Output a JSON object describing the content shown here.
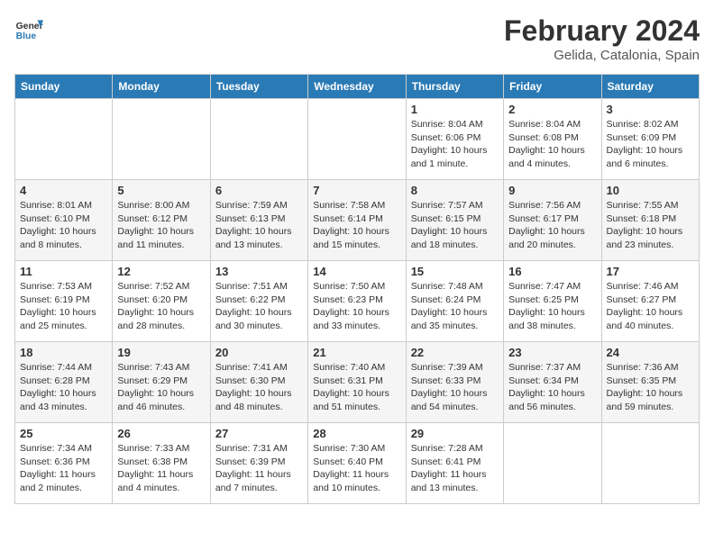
{
  "header": {
    "logo_text_general": "General",
    "logo_text_blue": "Blue",
    "title": "February 2024",
    "subtitle": "Gelida, Catalonia, Spain"
  },
  "weekdays": [
    "Sunday",
    "Monday",
    "Tuesday",
    "Wednesday",
    "Thursday",
    "Friday",
    "Saturday"
  ],
  "weeks": [
    [
      {
        "day": "",
        "info": ""
      },
      {
        "day": "",
        "info": ""
      },
      {
        "day": "",
        "info": ""
      },
      {
        "day": "",
        "info": ""
      },
      {
        "day": "1",
        "info": "Sunrise: 8:04 AM\nSunset: 6:06 PM\nDaylight: 10 hours and 1 minute."
      },
      {
        "day": "2",
        "info": "Sunrise: 8:04 AM\nSunset: 6:08 PM\nDaylight: 10 hours and 4 minutes."
      },
      {
        "day": "3",
        "info": "Sunrise: 8:02 AM\nSunset: 6:09 PM\nDaylight: 10 hours and 6 minutes."
      }
    ],
    [
      {
        "day": "4",
        "info": "Sunrise: 8:01 AM\nSunset: 6:10 PM\nDaylight: 10 hours and 8 minutes."
      },
      {
        "day": "5",
        "info": "Sunrise: 8:00 AM\nSunset: 6:12 PM\nDaylight: 10 hours and 11 minutes."
      },
      {
        "day": "6",
        "info": "Sunrise: 7:59 AM\nSunset: 6:13 PM\nDaylight: 10 hours and 13 minutes."
      },
      {
        "day": "7",
        "info": "Sunrise: 7:58 AM\nSunset: 6:14 PM\nDaylight: 10 hours and 15 minutes."
      },
      {
        "day": "8",
        "info": "Sunrise: 7:57 AM\nSunset: 6:15 PM\nDaylight: 10 hours and 18 minutes."
      },
      {
        "day": "9",
        "info": "Sunrise: 7:56 AM\nSunset: 6:17 PM\nDaylight: 10 hours and 20 minutes."
      },
      {
        "day": "10",
        "info": "Sunrise: 7:55 AM\nSunset: 6:18 PM\nDaylight: 10 hours and 23 minutes."
      }
    ],
    [
      {
        "day": "11",
        "info": "Sunrise: 7:53 AM\nSunset: 6:19 PM\nDaylight: 10 hours and 25 minutes."
      },
      {
        "day": "12",
        "info": "Sunrise: 7:52 AM\nSunset: 6:20 PM\nDaylight: 10 hours and 28 minutes."
      },
      {
        "day": "13",
        "info": "Sunrise: 7:51 AM\nSunset: 6:22 PM\nDaylight: 10 hours and 30 minutes."
      },
      {
        "day": "14",
        "info": "Sunrise: 7:50 AM\nSunset: 6:23 PM\nDaylight: 10 hours and 33 minutes."
      },
      {
        "day": "15",
        "info": "Sunrise: 7:48 AM\nSunset: 6:24 PM\nDaylight: 10 hours and 35 minutes."
      },
      {
        "day": "16",
        "info": "Sunrise: 7:47 AM\nSunset: 6:25 PM\nDaylight: 10 hours and 38 minutes."
      },
      {
        "day": "17",
        "info": "Sunrise: 7:46 AM\nSunset: 6:27 PM\nDaylight: 10 hours and 40 minutes."
      }
    ],
    [
      {
        "day": "18",
        "info": "Sunrise: 7:44 AM\nSunset: 6:28 PM\nDaylight: 10 hours and 43 minutes."
      },
      {
        "day": "19",
        "info": "Sunrise: 7:43 AM\nSunset: 6:29 PM\nDaylight: 10 hours and 46 minutes."
      },
      {
        "day": "20",
        "info": "Sunrise: 7:41 AM\nSunset: 6:30 PM\nDaylight: 10 hours and 48 minutes."
      },
      {
        "day": "21",
        "info": "Sunrise: 7:40 AM\nSunset: 6:31 PM\nDaylight: 10 hours and 51 minutes."
      },
      {
        "day": "22",
        "info": "Sunrise: 7:39 AM\nSunset: 6:33 PM\nDaylight: 10 hours and 54 minutes."
      },
      {
        "day": "23",
        "info": "Sunrise: 7:37 AM\nSunset: 6:34 PM\nDaylight: 10 hours and 56 minutes."
      },
      {
        "day": "24",
        "info": "Sunrise: 7:36 AM\nSunset: 6:35 PM\nDaylight: 10 hours and 59 minutes."
      }
    ],
    [
      {
        "day": "25",
        "info": "Sunrise: 7:34 AM\nSunset: 6:36 PM\nDaylight: 11 hours and 2 minutes."
      },
      {
        "day": "26",
        "info": "Sunrise: 7:33 AM\nSunset: 6:38 PM\nDaylight: 11 hours and 4 minutes."
      },
      {
        "day": "27",
        "info": "Sunrise: 7:31 AM\nSunset: 6:39 PM\nDaylight: 11 hours and 7 minutes."
      },
      {
        "day": "28",
        "info": "Sunrise: 7:30 AM\nSunset: 6:40 PM\nDaylight: 11 hours and 10 minutes."
      },
      {
        "day": "29",
        "info": "Sunrise: 7:28 AM\nSunset: 6:41 PM\nDaylight: 11 hours and 13 minutes."
      },
      {
        "day": "",
        "info": ""
      },
      {
        "day": "",
        "info": ""
      }
    ]
  ]
}
